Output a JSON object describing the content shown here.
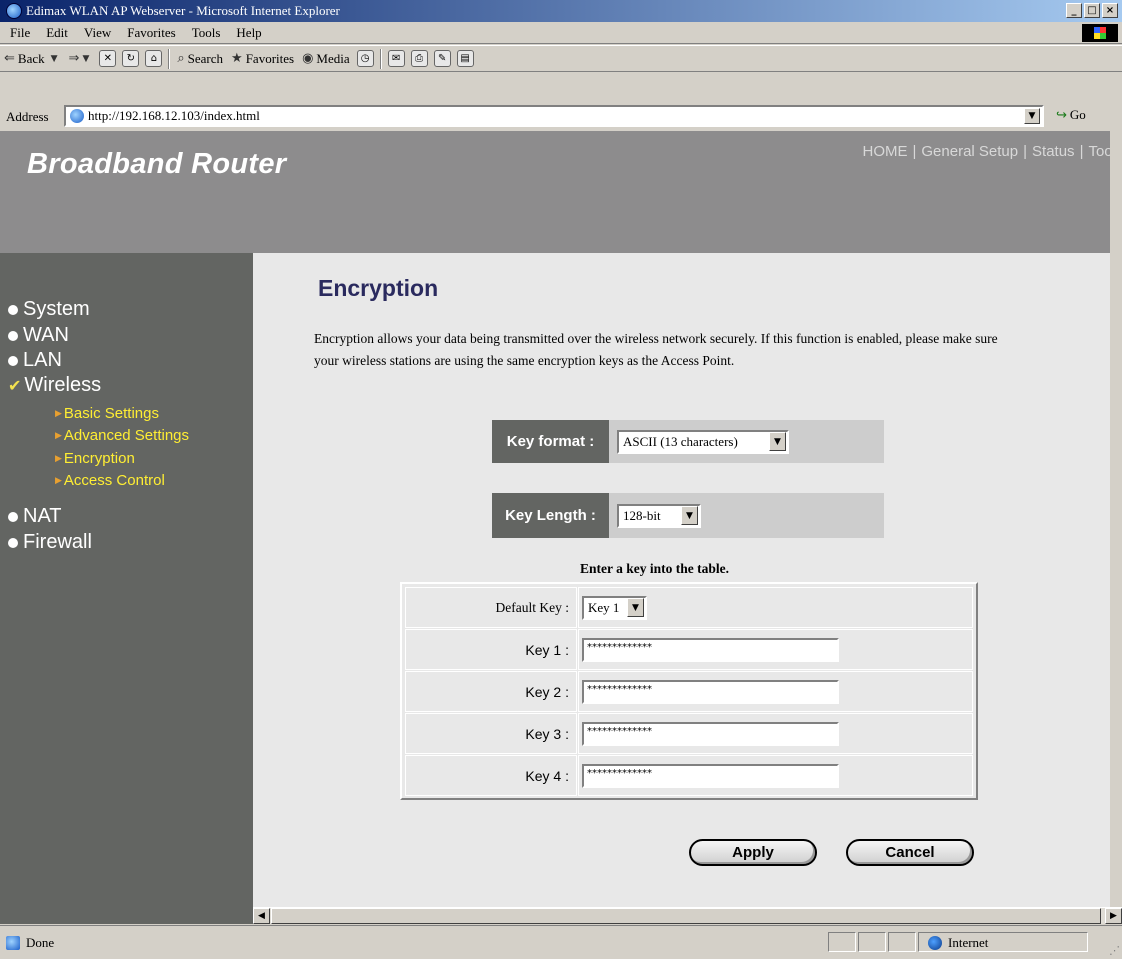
{
  "window": {
    "title": "Edimax WLAN AP Webserver - Microsoft Internet Explorer",
    "min": "_",
    "max": "□",
    "close": "×"
  },
  "menu": [
    "File",
    "Edit",
    "View",
    "Favorites",
    "Tools",
    "Help"
  ],
  "toolbar": {
    "back": "Back",
    "search": "Search",
    "favorites": "Favorites",
    "media": "Media"
  },
  "address": {
    "label": "Address",
    "url": "http://192.168.12.103/index.html",
    "go": "Go"
  },
  "header": {
    "brand": "Broadband Router",
    "nav": [
      "HOME",
      "General Setup",
      "Status",
      "Tool"
    ]
  },
  "sidebar": {
    "items": [
      "System",
      "WAN",
      "LAN",
      "Wireless",
      "NAT",
      "Firewall"
    ],
    "sub_items": [
      "Basic Settings",
      "Advanced Settings",
      "Encryption",
      "Access Control"
    ]
  },
  "main": {
    "title": "Encryption",
    "description": "Encryption allows your data being transmitted over the wireless network securely. If this function is enabled, please make sure your wireless stations are using the same encryption keys as the Access Point.",
    "key_format": {
      "label": "Key format :",
      "value": "ASCII (13 characters)"
    },
    "key_length": {
      "label": "Key Length :",
      "value": "128-bit"
    },
    "table_caption": "Enter a key into the table.",
    "default_key": {
      "label": "Default Key :",
      "value": "Key 1"
    },
    "keys": [
      {
        "label": "Key 1 :",
        "value": "*************"
      },
      {
        "label": "Key 2 :",
        "value": "*************"
      },
      {
        "label": "Key 3 :",
        "value": "*************"
      },
      {
        "label": "Key 4 :",
        "value": "*************"
      }
    ],
    "apply": "Apply",
    "cancel": "Cancel"
  },
  "status": {
    "text": "Done",
    "zone": "Internet"
  }
}
